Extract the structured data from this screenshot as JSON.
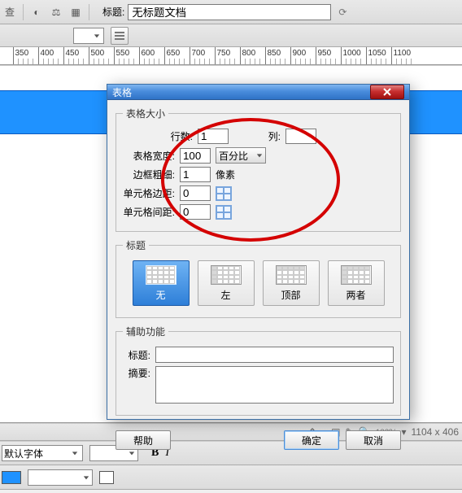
{
  "toolbar": {
    "title_label": "标题:",
    "title_value": "无标题文档"
  },
  "ruler": {
    "ticks": [
      350,
      400,
      450,
      500,
      550,
      600,
      650,
      700,
      750,
      800,
      850,
      900,
      950,
      1000,
      1050,
      1100
    ]
  },
  "dialog": {
    "title": "表格",
    "size": {
      "legend": "表格大小",
      "rows_label": "行数:",
      "rows_value": "1",
      "cols_label": "列:",
      "cols_value": "",
      "width_label": "表格宽度:",
      "width_value": "100",
      "width_unit": "百分比",
      "border_label": "边框粗细:",
      "border_value": "1",
      "border_unit": "像素",
      "cellpad_label": "单元格边距:",
      "cellpad_value": "0",
      "cellspace_label": "单元格间距:",
      "cellspace_value": "0"
    },
    "caption": {
      "legend": "标题",
      "options": [
        {
          "label": "无",
          "active": true
        },
        {
          "label": "左",
          "active": false
        },
        {
          "label": "顶部",
          "active": false
        },
        {
          "label": "两者",
          "active": false
        }
      ]
    },
    "access": {
      "legend": "辅助功能",
      "title_label": "标题:",
      "title_value": "",
      "summary_label": "摘要:",
      "summary_value": ""
    },
    "buttons": {
      "help": "帮助",
      "ok": "确定",
      "cancel": "取消"
    }
  },
  "status": {
    "zoom": "100%",
    "dims": "1104 x 406"
  },
  "prop": {
    "font": "默认字体",
    "bold": "B",
    "italic": "I"
  }
}
